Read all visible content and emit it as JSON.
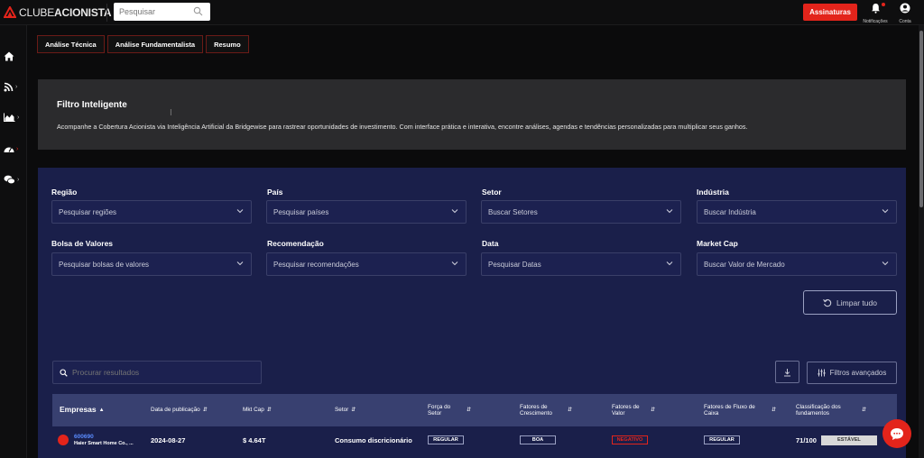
{
  "app": {
    "logo_text_light": "CLUBE",
    "logo_text_bold": "ACIONISTA"
  },
  "top_search": {
    "placeholder": "Pesquisar"
  },
  "topbar": {
    "subscribe_label": "Assinaturas",
    "notifications_label": "Notificações",
    "account_label": "Conta"
  },
  "tabs": [
    "Análise Técnica",
    "Análise Fundamentalista",
    "Resumo"
  ],
  "info": {
    "title": "Filtro Inteligente",
    "description": "Acompanhe a Cobertura Acionista via Inteligência Artificial da Bridgewise para rastrear oportunidades de investimento. Com interface prática e interativa, encontre análises, agendas e tendências personalizadas para multiplicar seus ganhos."
  },
  "filters": [
    {
      "label": "Região",
      "placeholder": "Pesquisar regiões"
    },
    {
      "label": "País",
      "placeholder": "Pesquisar países"
    },
    {
      "label": "Setor",
      "placeholder": "Buscar Setores"
    },
    {
      "label": "Indústria",
      "placeholder": "Buscar Indústria"
    },
    {
      "label": "Bolsa de Valores",
      "placeholder": "Pesquisar bolsas de valores"
    },
    {
      "label": "Recomendação",
      "placeholder": "Pesquisar recomendações"
    },
    {
      "label": "Data",
      "placeholder": "Pesquisar Datas"
    },
    {
      "label": "Market Cap",
      "placeholder": "Buscar Valor de Mercado"
    }
  ],
  "clear_label": "Limpar tudo",
  "results_search": {
    "placeholder": "Procurar resultados"
  },
  "advanced_filters_label": "Filtros avançados",
  "table": {
    "headers": [
      "Empresas",
      "Data de publicação",
      "Mkt Cap",
      "Setor",
      "Força do Setor",
      "Fatores de Crescimento",
      "Fatores de Valor",
      "Fatores de Fluxo de Caixa",
      "Classificação dos fundamentos"
    ],
    "rows": [
      {
        "ticker": "600690",
        "company": "Haier Smart Home Co., ...",
        "date": "2024-08-27",
        "mkt_cap": "$ 4.64T",
        "sector": "Consumo discricionário",
        "sector_strength": "REGULAR",
        "growth": "BOA",
        "value": "NEGATIVO",
        "cash_flow": "REGULAR",
        "score": "71/100",
        "score_badge": "ESTÁVEL"
      }
    ]
  },
  "colors": {
    "accent_red": "#e3241b",
    "panel_navy": "#1a1f4a",
    "table_header": "#384070",
    "ticker_blue": "#5a8cff"
  },
  "icons": {
    "sidebar": [
      "home-icon",
      "rss-icon",
      "chart-icon",
      "dashboard-icon",
      "chat-icon"
    ]
  }
}
